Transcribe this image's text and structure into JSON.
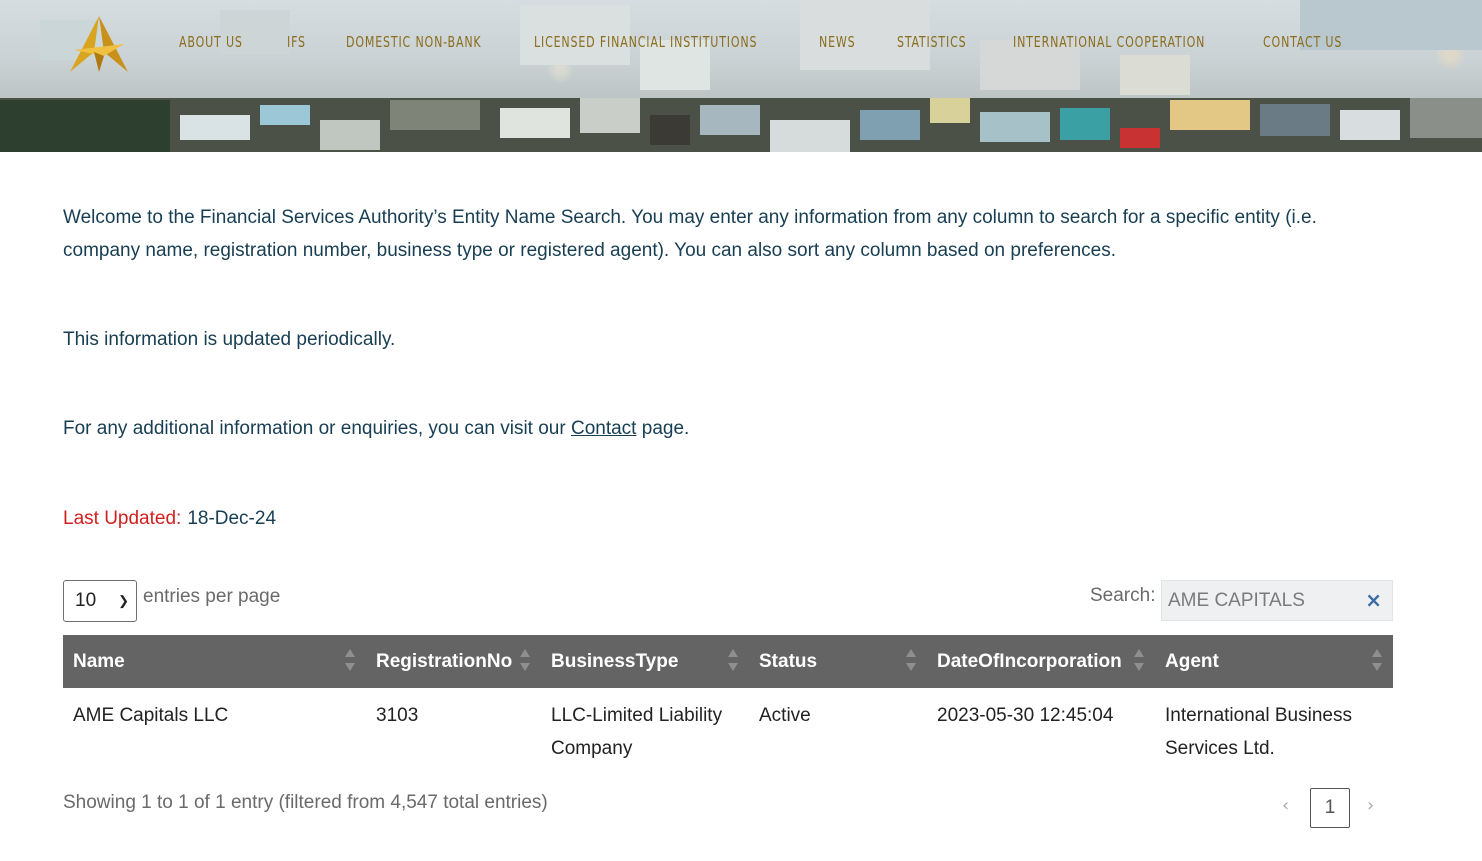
{
  "header": {
    "nav": [
      {
        "label": "ABOUT US"
      },
      {
        "label": "IFS"
      },
      {
        "label": "DOMESTIC NON-BANK"
      },
      {
        "label": "LICENSED FINANCIAL INSTITUTIONS"
      },
      {
        "label": "NEWS"
      },
      {
        "label": "STATISTICS"
      },
      {
        "label": "INTERNATIONAL COOPERATION"
      },
      {
        "label": "CONTACT US"
      }
    ],
    "colors": {
      "nav_text": "#8a6d1d",
      "logo": "#d9a520"
    }
  },
  "intro": {
    "paragraph1": "Welcome to the Financial Services Authority’s Entity Name Search. You may enter any information from any column to search for a specific entity (i.e. company name, registration number, business type or registered agent). You can also sort any column based on preferences.",
    "paragraph2": "This information is updated periodically.",
    "paragraph3_before": "For any additional information or enquiries, you can visit our ",
    "paragraph3_link": "Contact",
    "paragraph3_after": " page.",
    "last_updated_label": "Last Updated:",
    "last_updated_value": "18-Dec-24"
  },
  "table_controls": {
    "page_length": "10",
    "page_length_label": "entries per page",
    "search_label": "Search:",
    "search_value": "AME CAPITALS",
    "clear_icon": "×"
  },
  "table": {
    "columns": [
      "Name",
      "RegistrationNo",
      "BusinessType",
      "Status",
      "DateOfIncorporation",
      "Agent"
    ],
    "rows": [
      {
        "name": "AME Capitals LLC",
        "registration_no": "3103",
        "business_type": "LLC-Limited Liability Company",
        "status": "Active",
        "date_of_incorporation": "2023-05-30 12:45:04",
        "agent": "International Business Services Ltd."
      }
    ],
    "header_color": "#646464"
  },
  "footer": {
    "info": "Showing 1 to 1 of 1 entry (filtered from 4,547 total entries)",
    "prev": "‹",
    "current_page": "1",
    "next": "›"
  }
}
